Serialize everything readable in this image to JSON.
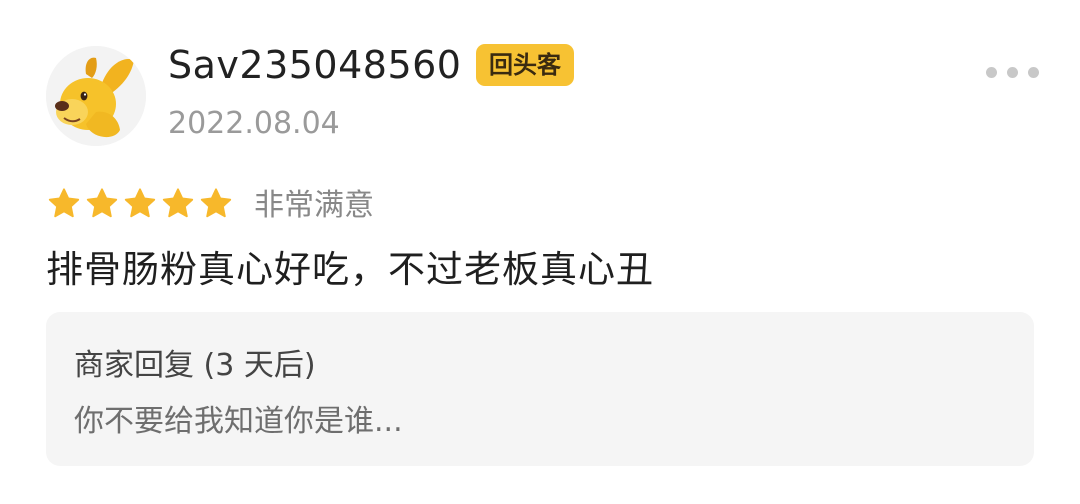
{
  "review": {
    "username": "Sav235048560",
    "badge": "回头客",
    "date": "2022.08.04",
    "rating": {
      "stars": 5,
      "max_stars": 5,
      "label": "非常满意"
    },
    "content": "排骨肠粉真心好吃，不过老板真心丑",
    "avatar_icon": "yellow-dog-avatar",
    "more_icon": "more-dots-icon"
  },
  "merchant_reply": {
    "title": "商家回复 (3 天后)",
    "content": "你不要给我知道你是谁..."
  },
  "colors": {
    "badge_bg": "#f7c233",
    "star": "#f7b82b",
    "reply_bg": "#f5f5f5"
  }
}
